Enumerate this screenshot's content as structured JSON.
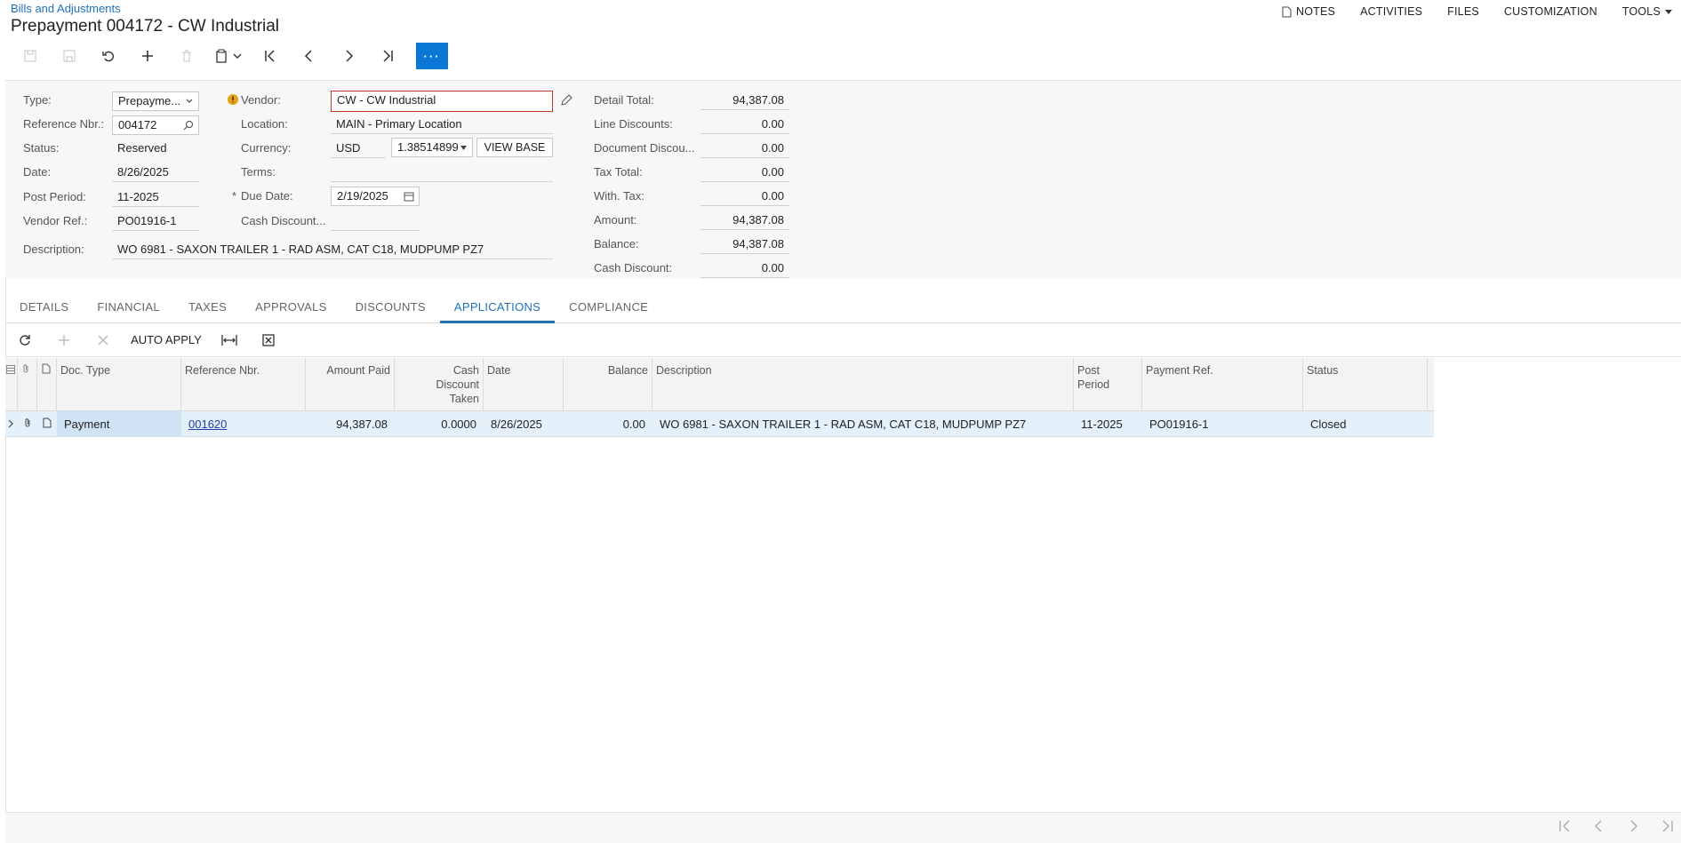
{
  "breadcrumb": "Bills and Adjustments",
  "title": "Prepayment 004172 - CW Industrial",
  "top_menu": {
    "notes": "NOTES",
    "activities": "ACTIVITIES",
    "files": "FILES",
    "customization": "CUSTOMIZATION",
    "tools": "TOOLS"
  },
  "toolbar": {
    "more": "···"
  },
  "form": {
    "type_label": "Type:",
    "type_value": "Prepayme...",
    "ref_label": "Reference Nbr.:",
    "ref_value": "004172",
    "status_label": "Status:",
    "status_value": "Reserved",
    "date_label": "Date:",
    "date_value": "8/26/2025",
    "post_period_label": "Post Period:",
    "post_period_value": "11-2025",
    "vendor_ref_label": "Vendor Ref.:",
    "vendor_ref_value": "PO01916-1",
    "description_label": "Description:",
    "description_value": "WO 6981 - SAXON TRAILER 1 - RAD ASM, CAT C18, MUDPUMP PZ7",
    "vendor_label": "Vendor:",
    "vendor_value": "CW - CW Industrial",
    "location_label": "Location:",
    "location_value": "MAIN - Primary Location",
    "currency_label": "Currency:",
    "currency_value": "USD",
    "rate_value": "1.38514899",
    "view_base": "VIEW BASE",
    "terms_label": "Terms:",
    "terms_value": "",
    "due_date_label": "Due Date:",
    "due_date_value": "2/19/2025",
    "cash_discount_label": "Cash Discount...",
    "cash_discount_value": "",
    "totals": [
      {
        "label": "Detail Total:",
        "value": "94,387.08"
      },
      {
        "label": "Line Discounts:",
        "value": "0.00"
      },
      {
        "label": "Document Discou...",
        "value": "0.00"
      },
      {
        "label": "Tax Total:",
        "value": "0.00"
      },
      {
        "label": "With. Tax:",
        "value": "0.00"
      },
      {
        "label": "Amount:",
        "value": "94,387.08"
      },
      {
        "label": "Balance:",
        "value": "94,387.08"
      },
      {
        "label": "Cash Discount:",
        "value": "0.00"
      }
    ]
  },
  "tabs": [
    "DETAILS",
    "FINANCIAL",
    "TAXES",
    "APPROVALS",
    "DISCOUNTS",
    "APPLICATIONS",
    "COMPLIANCE"
  ],
  "grid_toolbar": {
    "auto_apply": "AUTO APPLY"
  },
  "grid": {
    "headers": {
      "doc_type": "Doc. Type",
      "ref": "Reference Nbr.",
      "amount_paid": "Amount Paid",
      "cash_discount": "Cash Discount Taken",
      "date": "Date",
      "balance": "Balance",
      "description": "Description",
      "post_period": "Post Period",
      "payment_ref": "Payment Ref.",
      "status": "Status"
    },
    "row": {
      "doc_type": "Payment",
      "ref": "001620",
      "amount_paid": "94,387.08",
      "cash_discount": "0.0000",
      "date": "8/26/2025",
      "balance": "0.00",
      "description": "WO 6981 - SAXON TRAILER 1 - RAD ASM, CAT C18, MUDPUMP PZ7",
      "post_period": "11-2025",
      "payment_ref": "PO01916-1",
      "status": "Closed"
    }
  }
}
